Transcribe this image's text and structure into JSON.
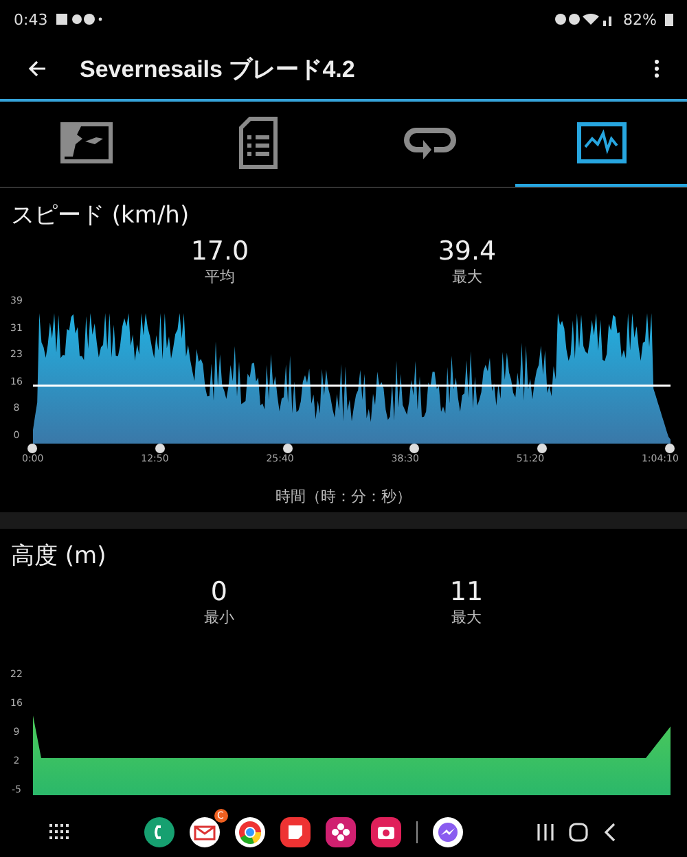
{
  "status_bar": {
    "time": "0:43",
    "battery": "82%"
  },
  "app_bar": {
    "title": "Severnesails ブレード4.2"
  },
  "tabs": [
    {
      "kind": "map",
      "selected": false
    },
    {
      "kind": "document",
      "selected": false
    },
    {
      "kind": "loop",
      "selected": false
    },
    {
      "kind": "chart",
      "selected": true
    }
  ],
  "speed": {
    "title": "スピード (km/h)",
    "stats": [
      {
        "value": "17.0",
        "label": "平均"
      },
      {
        "value": "39.4",
        "label": "最大"
      }
    ],
    "y_ticks": [
      "39",
      "31",
      "23",
      "16",
      "8",
      "0"
    ],
    "x_ticks": [
      "0:00",
      "12:50",
      "25:40",
      "38:30",
      "51:20",
      "1:04:10"
    ],
    "x_title": "時間（時：分：秒）"
  },
  "altitude": {
    "title": "高度 (m)",
    "stats": [
      {
        "value": "0",
        "label": "最小"
      },
      {
        "value": "11",
        "label": "最大"
      }
    ],
    "y_ticks": [
      "22",
      "16",
      "9",
      "2",
      "-5"
    ]
  },
  "dock": {
    "mail_badge": "C"
  }
}
